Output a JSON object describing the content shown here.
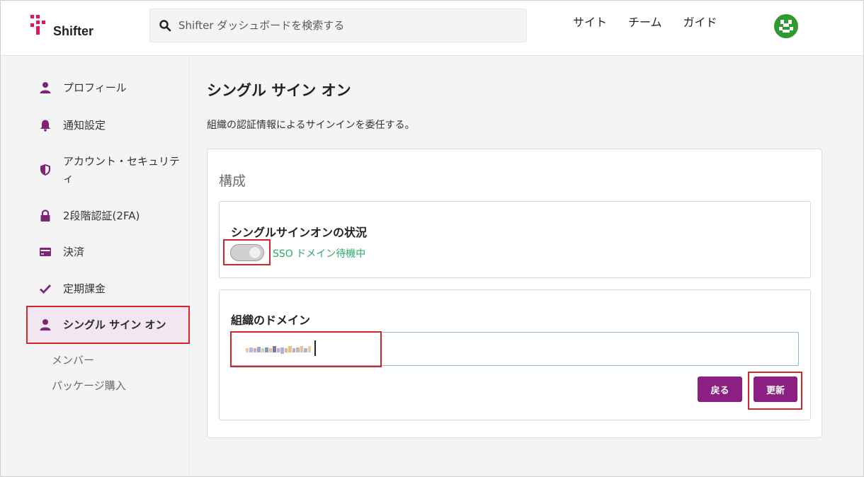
{
  "header": {
    "logo_text": "Shifter",
    "search_placeholder": "Shifter ダッシュボードを検索する",
    "nav": [
      "サイト",
      "チーム",
      "ガイド"
    ]
  },
  "sidebar": {
    "items": [
      {
        "label": "プロフィール",
        "icon": "user-icon"
      },
      {
        "label": "通知設定",
        "icon": "bell-icon"
      },
      {
        "label": "アカウント・セキュリティ",
        "icon": "shield-icon"
      },
      {
        "label": "2段階認証(2FA)",
        "icon": "lock-icon"
      },
      {
        "label": "決済",
        "icon": "credit-card-icon"
      },
      {
        "label": "定期課金",
        "icon": "check-icon"
      },
      {
        "label": "シングル サイン オン",
        "icon": "user-icon",
        "active": true
      }
    ],
    "sub_items": [
      "メンバー",
      "パッケージ購入"
    ]
  },
  "main": {
    "title": "シングル サイン オン",
    "description": "組織の認証情報によるサインインを委任する。",
    "card": {
      "title": "構成",
      "status_panel": {
        "label": "シングルサインオンの状況",
        "toggle_status": "SSO ドメイン待機中",
        "toggle_on": false
      },
      "domain_panel": {
        "label": "組織のドメイン",
        "back_button": "戻る",
        "update_button": "更新"
      }
    }
  },
  "colors": {
    "accent": "#8b1f82",
    "highlight": "#d4272c",
    "status_green": "#2bab6a",
    "logo_pink": "#e5145f"
  }
}
